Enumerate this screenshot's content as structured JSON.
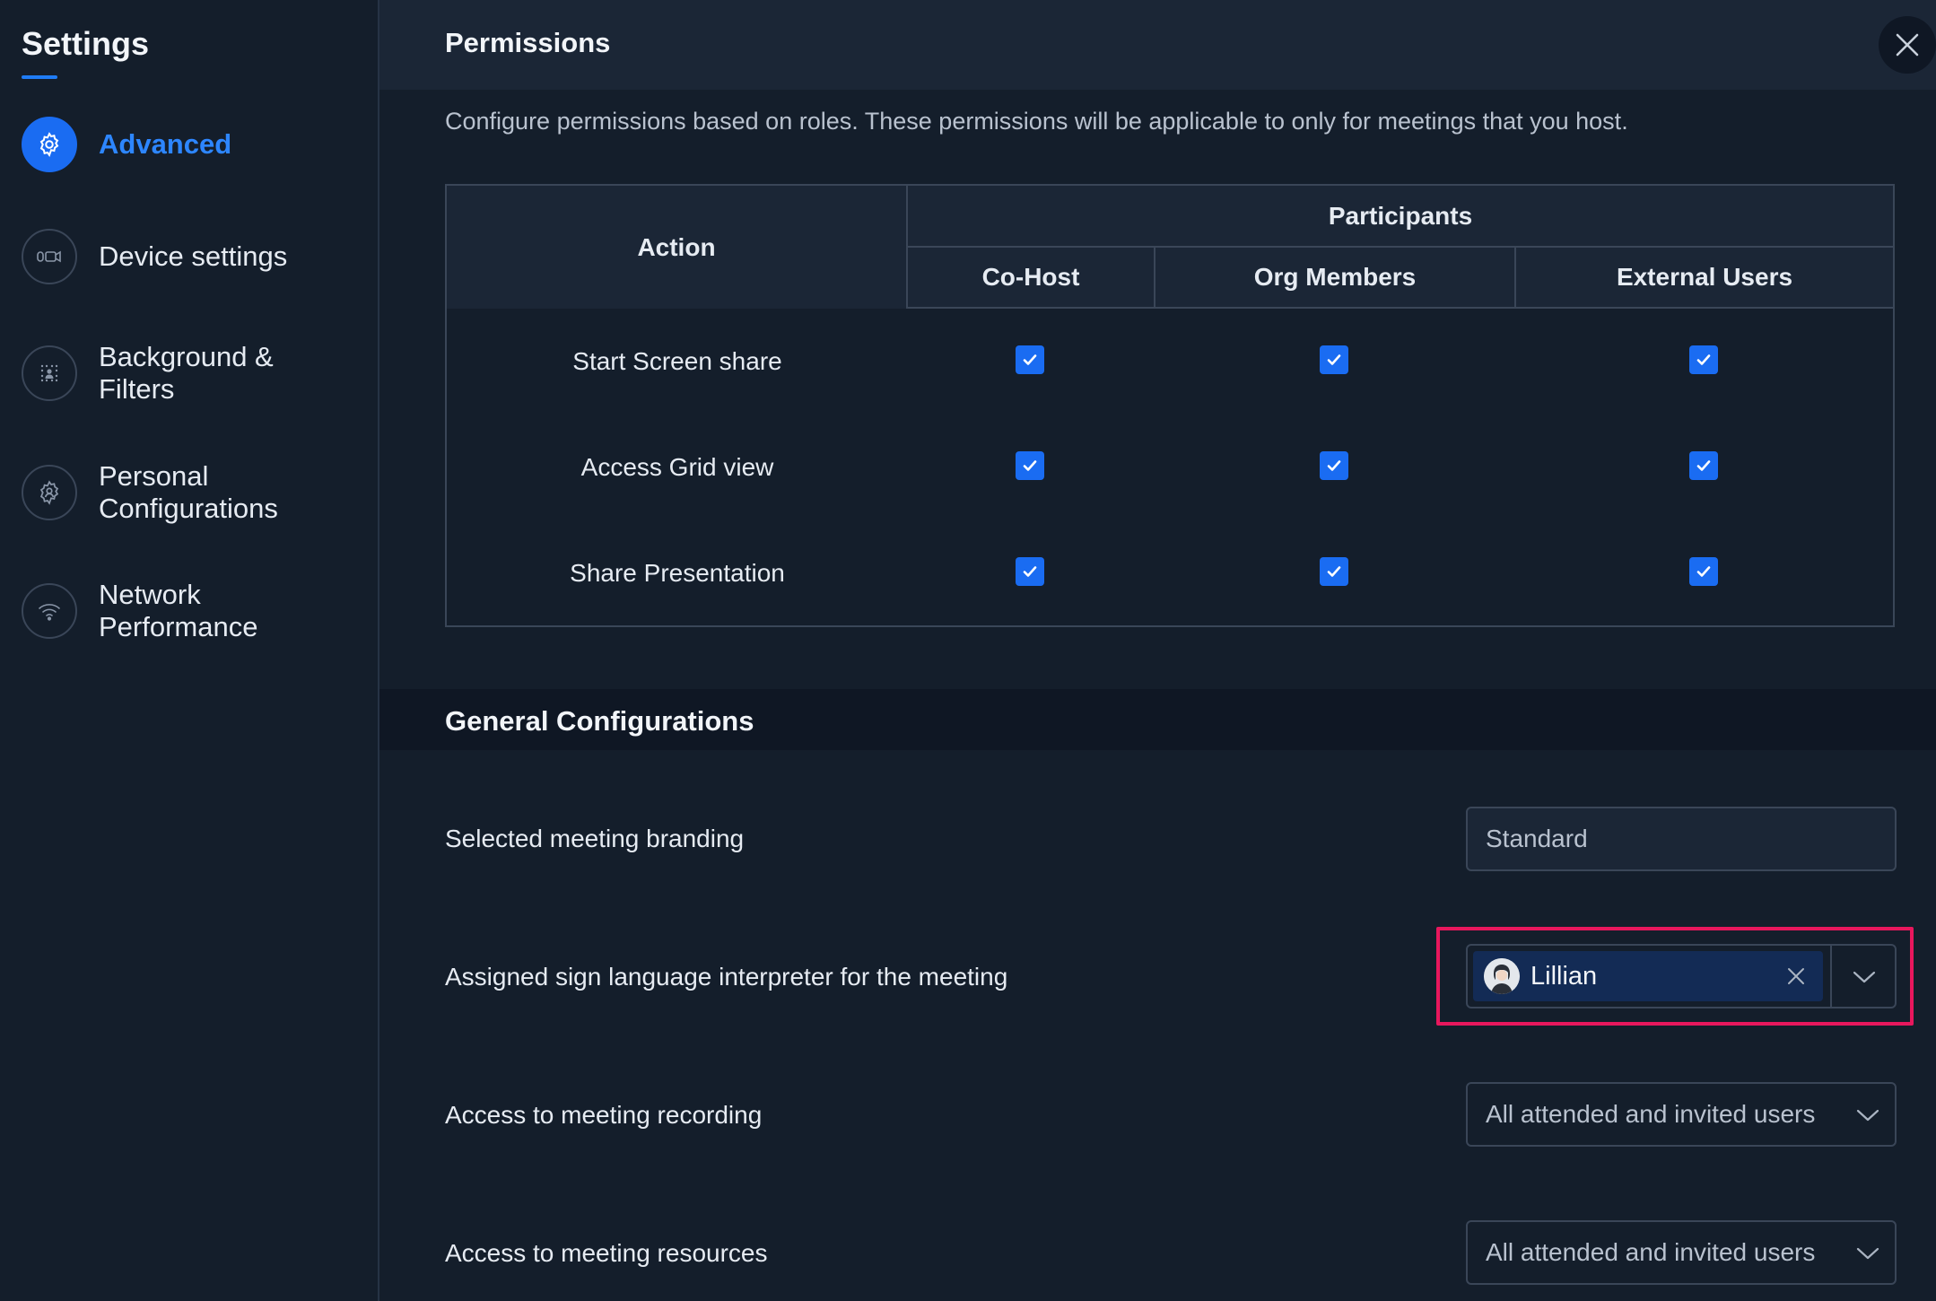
{
  "sidebar": {
    "title": "Settings",
    "items": [
      {
        "label": "Advanced",
        "icon": "gear-icon",
        "active": true
      },
      {
        "label": "Device settings",
        "icon": "camera-mic-icon"
      },
      {
        "label": "Background & Filters",
        "icon": "background-icon"
      },
      {
        "label": "Personal Configurations",
        "icon": "user-gear-icon"
      },
      {
        "label": "Network Performance",
        "icon": "wifi-icon"
      }
    ]
  },
  "permissions": {
    "title": "Permissions",
    "description": "Configure permissions based on roles. These permissions will be applicable to only for meetings that you host.",
    "table": {
      "action_header": "Action",
      "participants_header": "Participants",
      "columns": [
        "Co-Host",
        "Org Members",
        "External Users"
      ],
      "rows": [
        {
          "action": "Start Screen share",
          "values": [
            true,
            true,
            true
          ]
        },
        {
          "action": "Access Grid view",
          "values": [
            true,
            true,
            true
          ]
        },
        {
          "action": "Share Presentation",
          "values": [
            true,
            true,
            true
          ]
        }
      ]
    }
  },
  "general": {
    "title": "General Configurations",
    "branding": {
      "label": "Selected meeting branding",
      "value": "Standard"
    },
    "interpreter": {
      "label": "Assigned sign language interpreter for the meeting",
      "selected": "Lillian"
    },
    "recording": {
      "label": "Access to meeting recording",
      "value": "All attended and invited users"
    },
    "resources": {
      "label": "Access to meeting resources",
      "value": "All attended and invited users"
    }
  },
  "colors": {
    "accent": "#1a6cf2",
    "highlight": "#e8175d",
    "background": "#141e2b"
  }
}
